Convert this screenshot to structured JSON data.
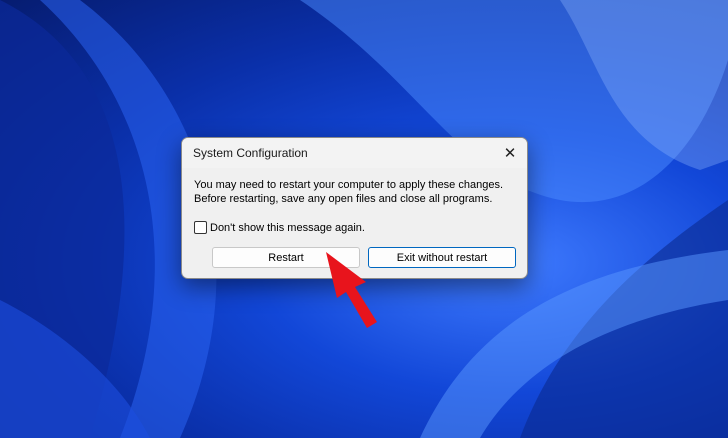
{
  "dialog": {
    "title": "System Configuration",
    "close_icon": "close-icon",
    "message_line1": "You may need to restart your computer to apply these changes.",
    "message_line2": "Before restarting, save any open files and close all programs.",
    "checkbox_label": "Don't show this message again.",
    "checkbox_checked": false,
    "restart_label": "Restart",
    "exit_label": "Exit without restart"
  },
  "colors": {
    "accent": "#0067c0",
    "arrow": "#e8141c"
  }
}
